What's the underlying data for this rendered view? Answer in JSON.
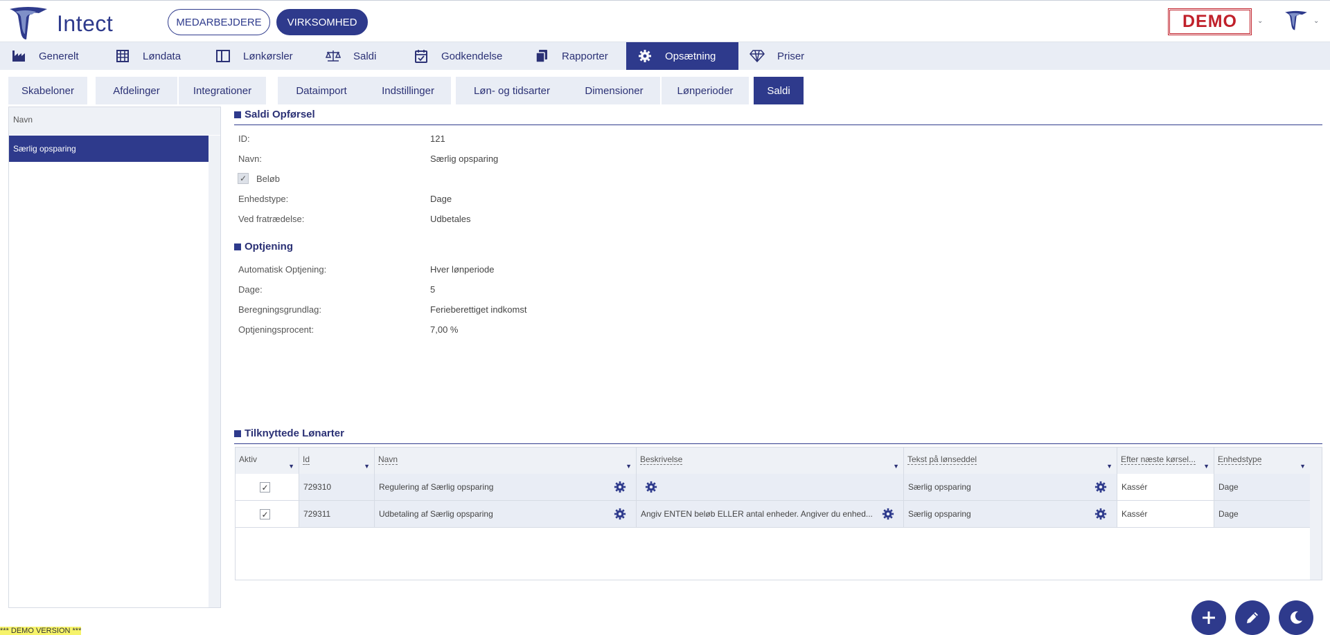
{
  "header": {
    "logo_text": "Intect",
    "btn_employees": "MEDARBEJDERE",
    "btn_company": "VIRKSOMHED",
    "demo_badge": "DEMO",
    "caret": "⌄"
  },
  "mainnav": [
    {
      "label": "Generelt",
      "icon": "factory-icon"
    },
    {
      "label": "Løndata",
      "icon": "table-icon"
    },
    {
      "label": "Lønkørsler",
      "icon": "columns-icon"
    },
    {
      "label": "Saldi",
      "icon": "scale-icon"
    },
    {
      "label": "Godkendelse",
      "icon": "calendar-check-icon"
    },
    {
      "label": "Rapporter",
      "icon": "copy-icon"
    },
    {
      "label": "Opsætning",
      "icon": "gear-icon",
      "active": true
    },
    {
      "label": "Priser",
      "icon": "diamond-icon"
    }
  ],
  "subtabs": [
    {
      "label": "Skabeloner"
    },
    {
      "label": "Afdelinger"
    },
    {
      "label": "Integrationer"
    },
    {
      "label": "Dataimport"
    },
    {
      "label": "Indstillinger"
    },
    {
      "label": "Løn- og tidsarter"
    },
    {
      "label": "Dimensioner"
    },
    {
      "label": "Lønperioder"
    },
    {
      "label": "Saldi",
      "active": true
    }
  ],
  "left_list": {
    "header": "Navn",
    "items": [
      "Særlig opsparing"
    ]
  },
  "details": {
    "title": "Saldi Opførsel",
    "id_label": "ID:",
    "id_value": "121",
    "name_label": "Navn:",
    "name_value": "Særlig opsparing",
    "amount_label": "Beløb",
    "amount_checked": true,
    "unit_type_label": "Enhedstype:",
    "unit_type_value": "Dage",
    "resign_label": "Ved fratrædelse:",
    "resign_value": "Udbetales"
  },
  "accrual": {
    "title": "Optjening",
    "auto_label": "Automatisk Optjening:",
    "auto_value": "Hver lønperiode",
    "days_label": "Dage:",
    "days_value": "5",
    "basis_label": "Beregningsgrundlag:",
    "basis_value": "Ferieberettiget indkomst",
    "percent_label": "Optjeningsprocent:",
    "percent_value": "7,00 %"
  },
  "linked": {
    "title": "Tilknyttede Lønarter",
    "columns": [
      "Aktiv",
      "Id",
      "Navn",
      "Beskrivelse",
      "Tekst på lønseddel",
      "Efter næste kørsel...",
      "Enhedstype"
    ],
    "rows": [
      {
        "active": true,
        "id": "729310",
        "name": "Regulering af Særlig opsparing",
        "description": "",
        "payslip_text": "Særlig opsparing",
        "after_next": "Kassér",
        "unit": "Dage"
      },
      {
        "active": true,
        "id": "729311",
        "name": "Udbetaling af Særlig opsparing",
        "description": "Angiv ENTEN beløb ELLER antal enheder. Angiver du enhed...",
        "payslip_text": "Særlig opsparing",
        "after_next": "Kassér",
        "unit": "Dage"
      }
    ]
  },
  "fabs": {
    "add": "plus-icon",
    "edit": "pencil-icon",
    "theme": "moon-icon"
  },
  "colors": {
    "primary": "#2e3a8c",
    "nav_bg": "#e9edf5",
    "demo_red": "#c0202a"
  },
  "footer": {
    "demo_label": "*** DEMO VERSION ***"
  }
}
